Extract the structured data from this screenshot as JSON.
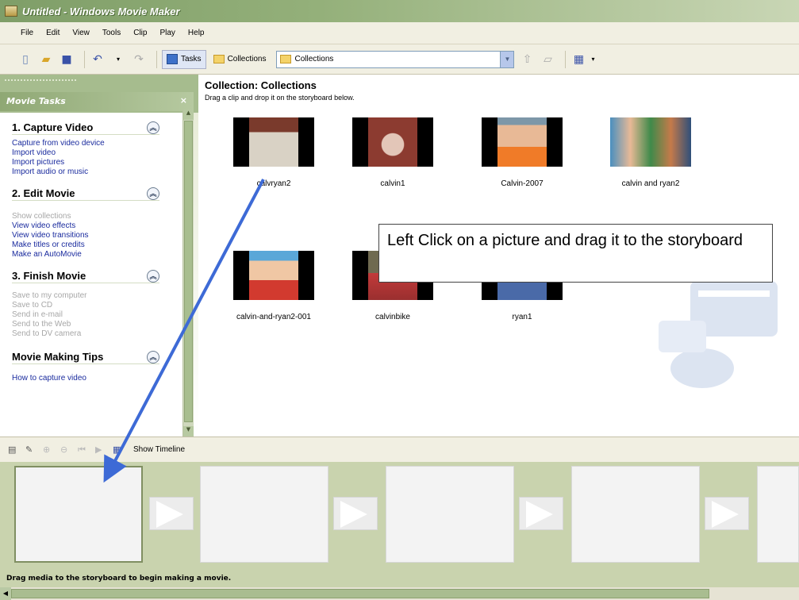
{
  "window": {
    "title": "Untitled - Windows Movie Maker"
  },
  "menu": [
    "File",
    "Edit",
    "View",
    "Tools",
    "Clip",
    "Play",
    "Help"
  ],
  "toolbar": {
    "tasks_label": "Tasks",
    "collections_label": "Collections",
    "collection_combo_value": "Collections"
  },
  "task_pane": {
    "header": "Movie Tasks",
    "close_glyph": "×",
    "sections": [
      {
        "title": "1. Capture Video",
        "items": [
          {
            "label": "Capture from video device",
            "enabled": true
          },
          {
            "label": "Import video",
            "enabled": true
          },
          {
            "label": "Import pictures",
            "enabled": true
          },
          {
            "label": "Import audio or music",
            "enabled": true
          }
        ]
      },
      {
        "title": "2. Edit Movie",
        "items": [
          {
            "label": "Show collections",
            "enabled": false
          },
          {
            "label": "View video effects",
            "enabled": true
          },
          {
            "label": "View video transitions",
            "enabled": true
          },
          {
            "label": "Make titles or credits",
            "enabled": true
          },
          {
            "label": "Make an AutoMovie",
            "enabled": true
          }
        ]
      },
      {
        "title": "3. Finish Movie",
        "items": [
          {
            "label": "Save to my computer",
            "enabled": false
          },
          {
            "label": "Save to CD",
            "enabled": false
          },
          {
            "label": "Send in e-mail",
            "enabled": false
          },
          {
            "label": "Send to the Web",
            "enabled": false
          },
          {
            "label": "Send to DV camera",
            "enabled": false
          }
        ]
      },
      {
        "title": "Movie Making Tips",
        "items": [
          {
            "label": "How to capture video",
            "enabled": true
          }
        ]
      }
    ]
  },
  "collection": {
    "title": "Collection: Collections",
    "subtitle": "Drag a clip and drop it on the storyboard below.",
    "clips": [
      {
        "label": "calvryan2",
        "colors": [
          "#7a3a2c",
          "#d9d2c5"
        ]
      },
      {
        "label": "calvin1",
        "colors": [
          "#8c3b30",
          "#e3c6b8"
        ]
      },
      {
        "label": "Calvin-2007",
        "colors": [
          "#7d97a8",
          "#f07b28"
        ]
      },
      {
        "label": "calvin and ryan2",
        "colors": [
          "#4a8fbf",
          "#3f8a4a"
        ]
      },
      {
        "label": "calvin-and-ryan2-001",
        "colors": [
          "#5aa7d8",
          "#d23a2f"
        ]
      },
      {
        "label": "calvinbike",
        "colors": [
          "#6f6a50",
          "#c23a3a"
        ]
      },
      {
        "label": "ryan1",
        "colors": [
          "#7a6a4a",
          "#4a6aa8"
        ]
      }
    ]
  },
  "callout": {
    "text": "Left Click on a picture and drag it to the storyboard"
  },
  "storyboard_toolbar": {
    "show_timeline_label": "Show Timeline"
  },
  "status": {
    "text": "Drag media to the storyboard to begin making a movie."
  },
  "colors": {
    "arrow": "#3d6ad6",
    "pane_header": "#a6bc8e",
    "link": "#1a2b9e"
  }
}
